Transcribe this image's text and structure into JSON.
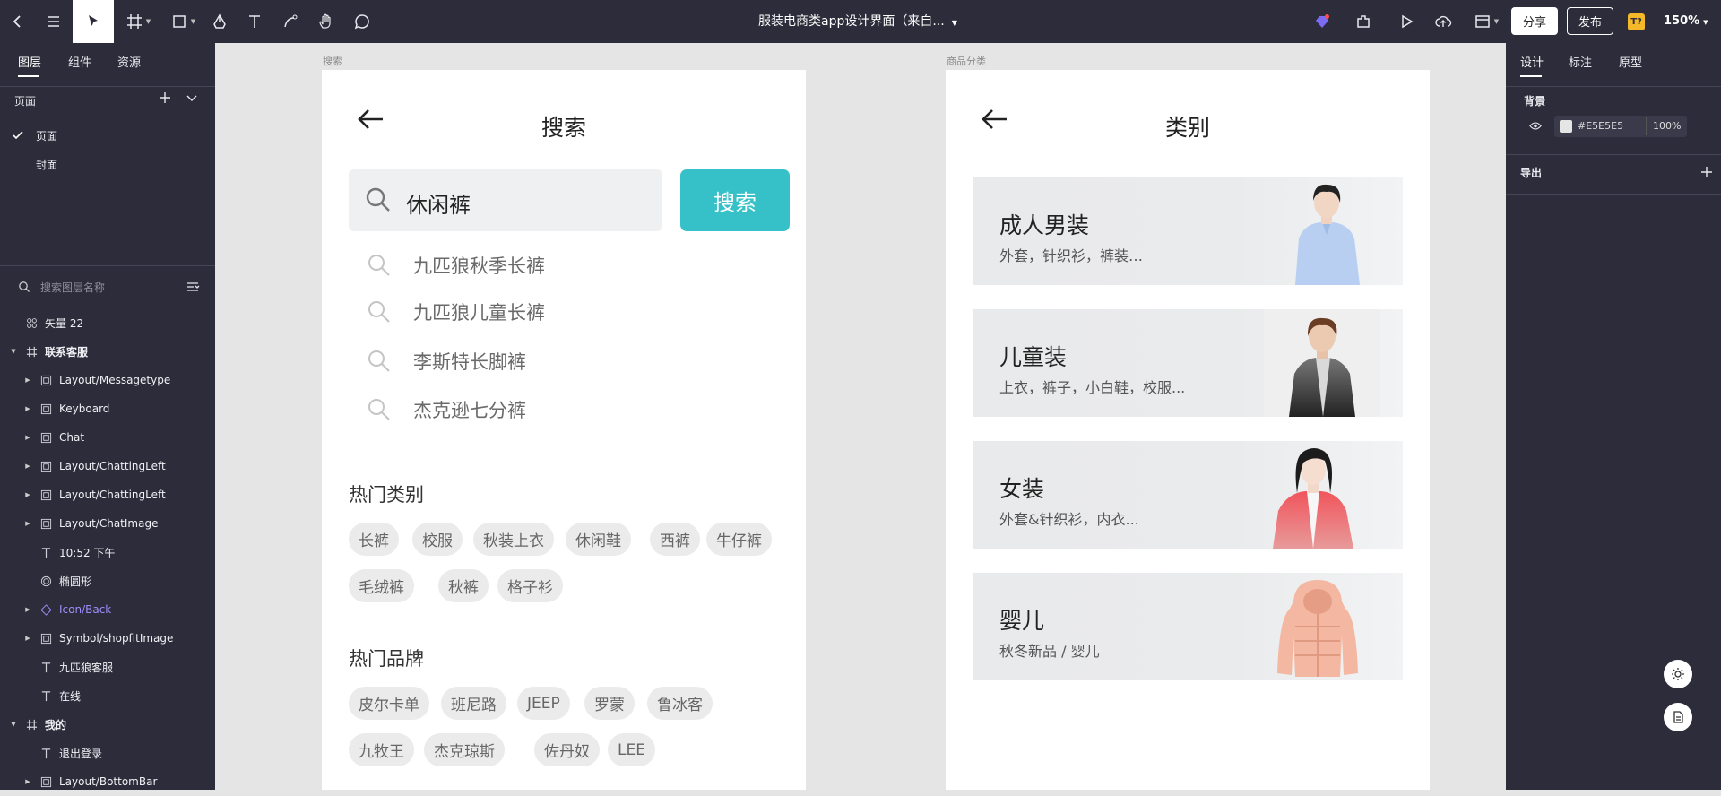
{
  "toolbar": {
    "doc_title": "服装电商类app设计界面（来自...",
    "share_label": "分享",
    "publish_label": "发布",
    "zoom": "150%",
    "badge": "T?"
  },
  "left_panel": {
    "tabs": [
      "图层",
      "组件",
      "资源"
    ],
    "pages_header": "页面",
    "pages": [
      "页面",
      "封面"
    ],
    "search_placeholder": "搜索图层名称",
    "layers": [
      {
        "name": "矢量 22",
        "icon": "vector-icon"
      },
      {
        "name": "联系客服",
        "icon": "frame-icon"
      },
      {
        "name": "Layout/Messagetype",
        "icon": "component-icon"
      },
      {
        "name": "Keyboard",
        "icon": "component-icon"
      },
      {
        "name": "Chat",
        "icon": "component-icon"
      },
      {
        "name": "Layout/ChattingLeft",
        "icon": "component-icon"
      },
      {
        "name": "Layout/ChattingLeft",
        "icon": "component-icon"
      },
      {
        "name": "Layout/ChatImage",
        "icon": "component-icon"
      },
      {
        "name": "10:52 下午",
        "icon": "text-icon"
      },
      {
        "name": "椭圆形",
        "icon": "ellipse-icon"
      },
      {
        "name": "Icon/Back",
        "icon": "instance-icon"
      },
      {
        "name": "Symbol/shopfitImage",
        "icon": "component-icon"
      },
      {
        "name": "九匹狼客服",
        "icon": "text-icon"
      },
      {
        "name": "在线",
        "icon": "text-icon"
      },
      {
        "name": "我的",
        "icon": "frame-icon"
      },
      {
        "name": "退出登录",
        "icon": "text-icon"
      },
      {
        "name": "Layout/BottomBar",
        "icon": "component-icon"
      }
    ]
  },
  "right_panel": {
    "tabs": [
      "设计",
      "标注",
      "原型"
    ],
    "background_label": "背景",
    "color_hex": "#E5E5E5",
    "opacity": "100%",
    "export_label": "导出"
  },
  "search_frame": {
    "label": "搜索",
    "title": "搜索",
    "query": "休闲裤",
    "button": "搜索",
    "suggestions": [
      "九匹狼秋季长裤",
      "九匹狼儿童长裤",
      "李斯特长脚裤",
      "杰克逊七分裤"
    ],
    "hot_categories_title": "热门类别",
    "hot_categories": [
      "长裤",
      "校服",
      "秋装上衣",
      "休闲鞋",
      "西裤",
      "牛仔裤",
      "毛绒裤",
      "秋裤",
      "格子衫"
    ],
    "hot_brands_title": "热门品牌",
    "hot_brands": [
      "皮尔卡单",
      "班尼路",
      "JEEP",
      "罗蒙",
      "鲁冰客",
      "九牧王",
      "杰克琼斯",
      "佐丹奴",
      "LEE"
    ]
  },
  "category_frame": {
    "label": "商品分类",
    "title": "类别",
    "cards": [
      {
        "title": "成人男装",
        "subtitle": "外套，针织衫，裤装…"
      },
      {
        "title": "儿童装",
        "subtitle": "上衣，裤子，小白鞋，校服..."
      },
      {
        "title": "女装",
        "subtitle": "外套&针织衫，内衣..."
      },
      {
        "title": "婴儿",
        "subtitle": "秋冬新品  / 婴儿"
      }
    ]
  },
  "colors": {
    "accent": "#36C1C8",
    "chrome": "#2C2C3A",
    "canvas": "#E5E5E5"
  }
}
